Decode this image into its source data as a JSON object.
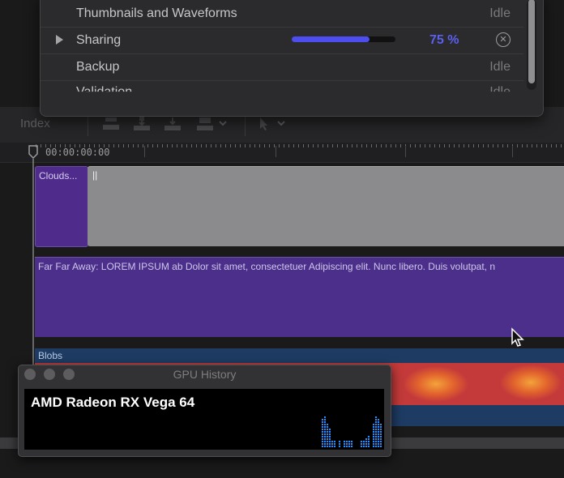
{
  "background_tasks": {
    "rows": [
      {
        "name": "Thumbnails and Waveforms",
        "status": "Idle"
      },
      {
        "name": "Sharing",
        "progress": 0.75,
        "percent_label": "75 %"
      },
      {
        "name": "Backup",
        "status": "Idle"
      },
      {
        "name": "Validation",
        "status": "Idle"
      }
    ]
  },
  "toolbar": {
    "index_label": "Index",
    "icons": [
      "connect-clip-icon",
      "insert-clip-icon",
      "append-clip-icon",
      "overwrite-clip-icon",
      "select-tool-icon"
    ]
  },
  "timeline": {
    "timecode": "00:00:00:00",
    "clips": {
      "clouds": "Clouds...",
      "gray_marker": "||",
      "title": "Far Far Away: LOREM IPSUM ab   Dolor sit amet, consectetuer Adipiscing elit. Nunc libero. Duis volutpat, n",
      "blobs": "Blobs"
    }
  },
  "gpu_history": {
    "window_title": "GPU History",
    "gpu_name": "AMD Radeon RX Vega 64",
    "bar_color": "#1e90ff",
    "bars": [
      0,
      0,
      0,
      0,
      0,
      0,
      0,
      0,
      0,
      0,
      0,
      0,
      0,
      0,
      0,
      0,
      0,
      0,
      0,
      0,
      0,
      0,
      0,
      0,
      0,
      0,
      0,
      0,
      0,
      0,
      0,
      0,
      0,
      0,
      0,
      0,
      0,
      0,
      0,
      0,
      0,
      0,
      0,
      0,
      0,
      0,
      0,
      0,
      0,
      0,
      0,
      0,
      0,
      0,
      0,
      0,
      0,
      0,
      0,
      0,
      0,
      0,
      0,
      0,
      0,
      0,
      0,
      0,
      0,
      0,
      0,
      0,
      0,
      0,
      0,
      0,
      0,
      0,
      0,
      0,
      0,
      0,
      0,
      0,
      0,
      0,
      0,
      0,
      0,
      0,
      0,
      0,
      0,
      0,
      0,
      0,
      0,
      0,
      0,
      0,
      0,
      0,
      0,
      0.45,
      0.5,
      0.4,
      0.3,
      0.1,
      0.1,
      0,
      0.1,
      0,
      0.1,
      0.1,
      0.1,
      0.1,
      0,
      0,
      0,
      0.1,
      0.1,
      0.15,
      0.2,
      0,
      0.4,
      0.5,
      0.45,
      0.4
    ]
  }
}
